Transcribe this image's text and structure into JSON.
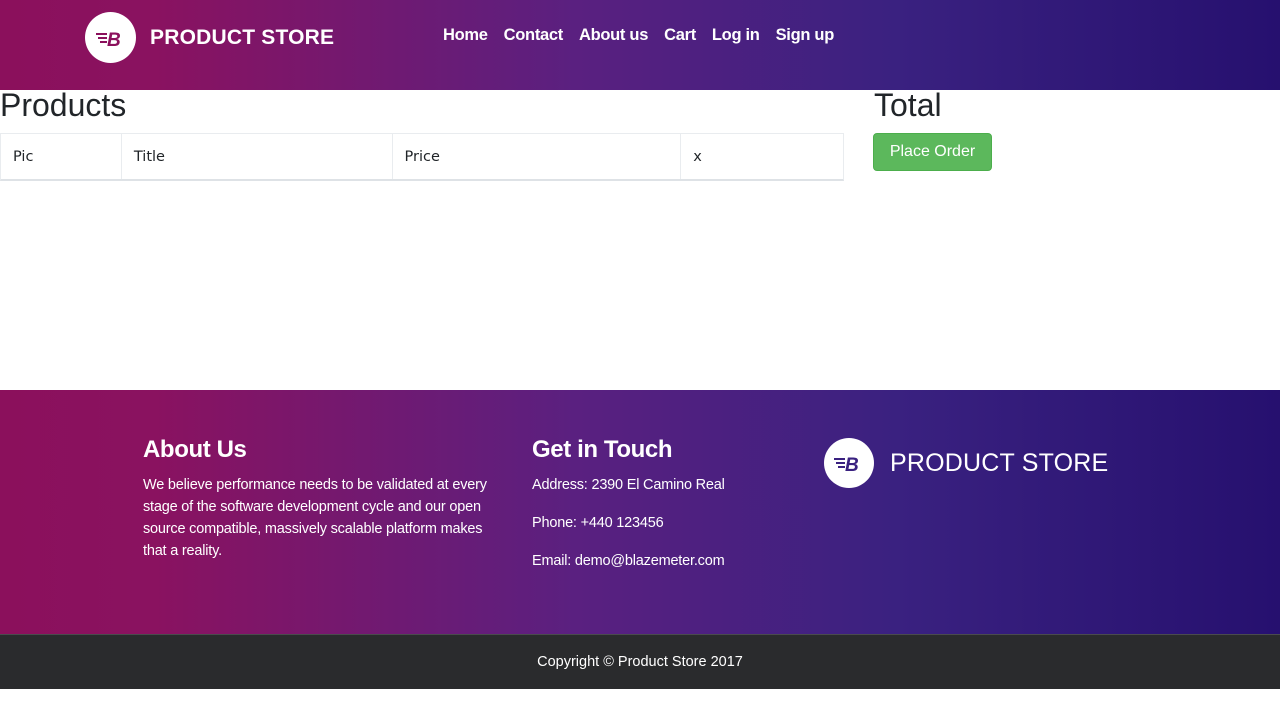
{
  "navbar": {
    "brand": "PRODUCT STORE",
    "logo_icon": "blazemeter-b-logo",
    "links": [
      "Home",
      "Contact",
      "About us",
      "Cart",
      "Log in",
      "Sign up"
    ]
  },
  "cart": {
    "products_title": "Products",
    "columns": [
      "Pic",
      "Title",
      "Price",
      "x"
    ],
    "total_title": "Total",
    "place_order_label": "Place Order"
  },
  "footer": {
    "about": {
      "heading": "About Us",
      "text": "We believe performance needs to be validated at every stage of the software development cycle and our open source compatible, massively scalable platform makes that a reality."
    },
    "contact": {
      "heading": "Get in Touch",
      "address": "Address: 2390 El Camino Real",
      "phone": "Phone: +440 123456",
      "email": "Email: demo@blazemeter.com"
    },
    "brand": "PRODUCT STORE",
    "copyright": "Copyright © Product Store 2017"
  },
  "colors": {
    "gradient_start": "#8b105c",
    "gradient_end": "#26106f",
    "place_order_bg": "#5cb85c",
    "copyright_bg": "#2a2b2d"
  }
}
